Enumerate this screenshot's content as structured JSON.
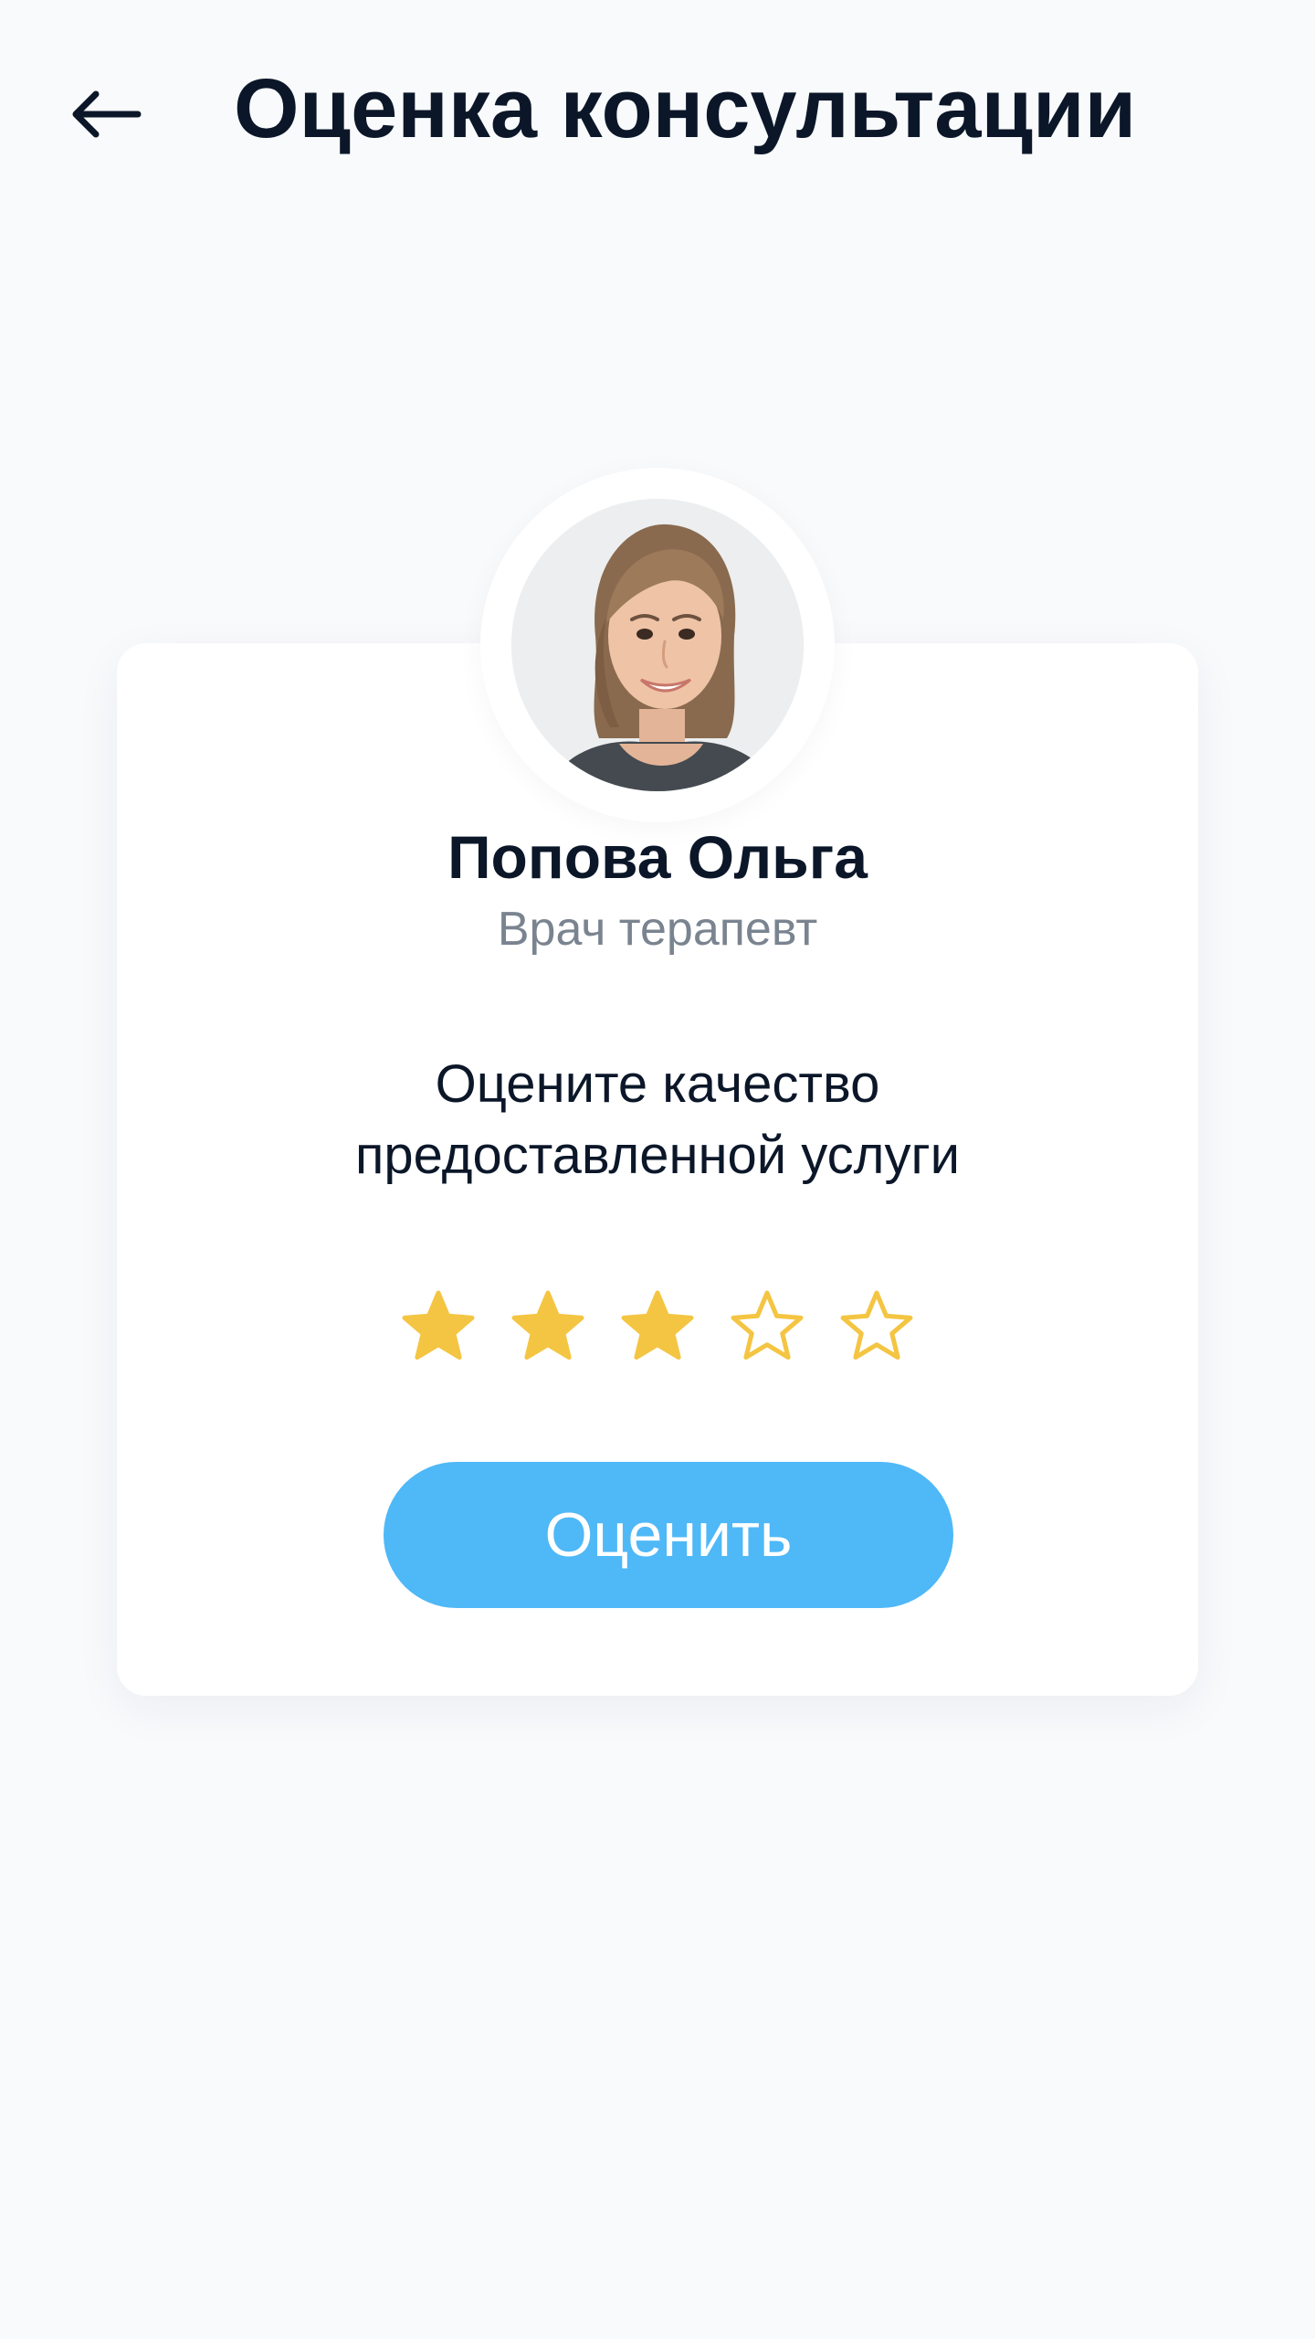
{
  "header": {
    "back_icon": "arrow-left-icon",
    "title": "Оценка консультации"
  },
  "doctor": {
    "avatar_icon": "doctor-avatar",
    "name": "Попова Ольга",
    "role": "Врач терапевт"
  },
  "rating": {
    "prompt_line1": "Оцените качество",
    "prompt_line2": "предоставленной услуги",
    "value": 3,
    "max": 5,
    "star_icon": "star-icon",
    "filled_color": "#f4c542",
    "empty_color": "#f4c542"
  },
  "submit": {
    "label": "Оценить",
    "color": "#4fb8f7"
  },
  "colors": {
    "background": "#f9fafc",
    "card": "#ffffff",
    "title_text": "#0b1729",
    "secondary_text": "#7a8490"
  }
}
